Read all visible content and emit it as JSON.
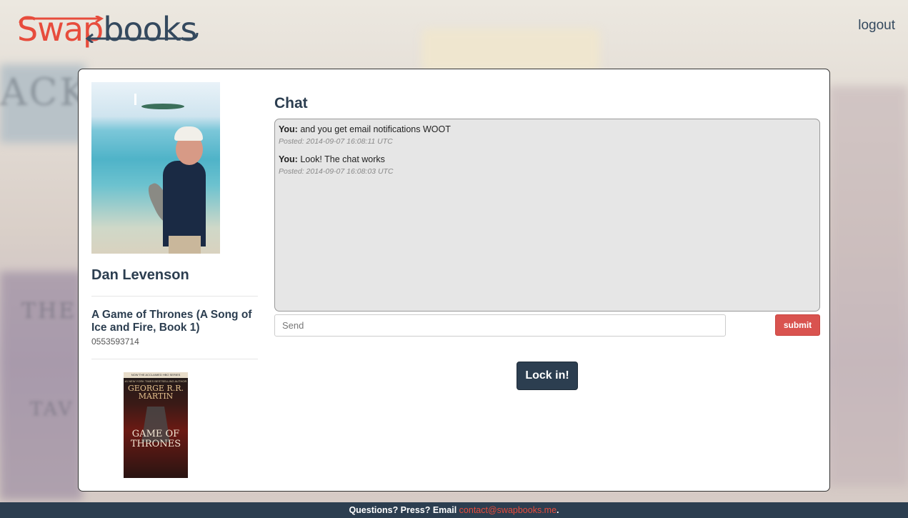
{
  "brand": {
    "swap": "Swap",
    "books": "books"
  },
  "header": {
    "logout_label": "logout"
  },
  "profile": {
    "name": "Dan Levenson",
    "book_title": "A Game of Thrones (A Song of Ice and Fire, Book 1)",
    "isbn": "0553593714"
  },
  "cover": {
    "band": "NOW THE ACCLAIMED HBO SERIES",
    "small": "#1 NEW YORK TIMES BESTSELLING AUTHOR",
    "author": "GEORGE R.R. MARTIN",
    "title": "GAME OF THRONES"
  },
  "chat": {
    "heading": "Chat",
    "messages": [
      {
        "sender": "You:",
        "text": "and you get email notifications WOOT",
        "meta": "Posted: 2014-09-07 16:08:11 UTC"
      },
      {
        "sender": "You:",
        "text": "Look! The chat works",
        "meta": "Posted: 2014-09-07 16:08:03 UTC"
      }
    ],
    "input_placeholder": "Send",
    "submit_label": "submit"
  },
  "actions": {
    "lock_in_label": "Lock in!"
  },
  "footer": {
    "text": "Questions? Press? Email ",
    "email": "contact@swapbooks.me",
    "end": "."
  },
  "colors": {
    "accent": "#e74c3c",
    "primary": "#2c3e50",
    "danger": "#d9534f"
  }
}
